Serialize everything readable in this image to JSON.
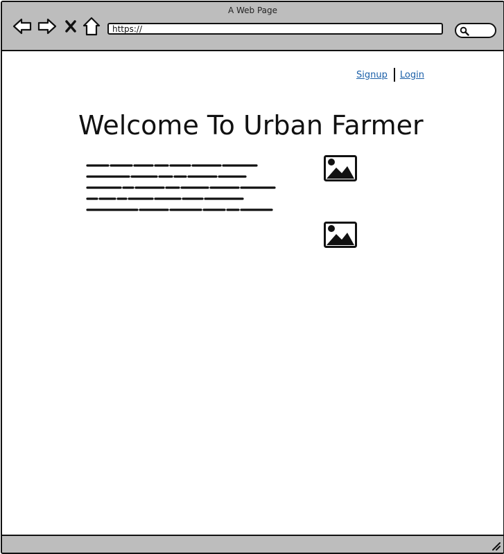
{
  "window": {
    "title": "A Web Page"
  },
  "browser": {
    "address": "https://",
    "icons": {
      "back": "back-arrow-icon",
      "forward": "forward-arrow-icon",
      "stop": "close-icon",
      "home": "home-icon",
      "search": "search-icon"
    }
  },
  "header": {
    "signup_label": "Signup",
    "login_label": "Login"
  },
  "main": {
    "title": "Welcome To Urban Farmer",
    "images": [
      "image-icon",
      "image-icon"
    ]
  },
  "colors": {
    "chrome": "#bdbdbd",
    "link": "#1a5fa8",
    "ink": "#111111"
  }
}
